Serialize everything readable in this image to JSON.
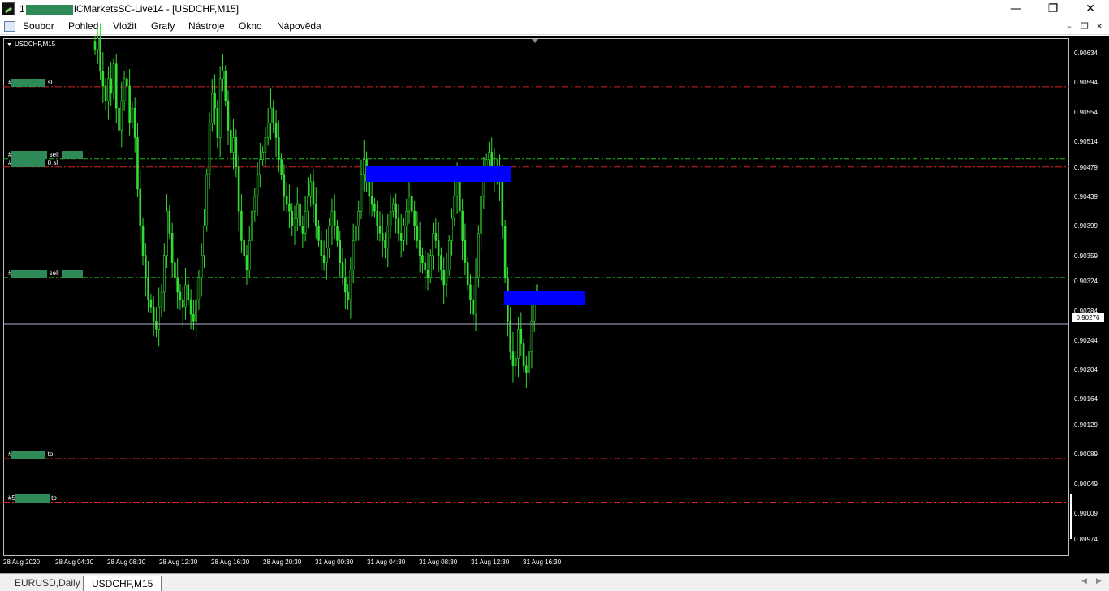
{
  "window": {
    "title_prefix": "1",
    "title_suffix": "ICMarketsSC-Live14 - [USDCHF,M15]",
    "minimize": "—",
    "restore": "❐",
    "close": "✕"
  },
  "menu": {
    "items": [
      "Soubor",
      "Pohled",
      "Vložit",
      "Grafy",
      "Nástroje",
      "Okno",
      "Nápověda"
    ],
    "mdi_minimize": "–",
    "mdi_restore": "❐",
    "mdi_close": "✕"
  },
  "chart": {
    "symbol": "USDCHF,M15",
    "current_price": "0.90276",
    "candle_color": "#33dd33",
    "zone_color": "#0000ff",
    "sl_tp_line_color": "#dd2222",
    "order_line_color": "#22bb22",
    "price_ticks": [
      "0.90634",
      "0.90594",
      "0.90554",
      "0.90514",
      "0.90479",
      "0.90439",
      "0.90399",
      "0.90359",
      "0.90324",
      "0.90284",
      "0.90244",
      "0.90204",
      "0.90164",
      "0.90129",
      "0.90089",
      "0.90049",
      "0.90009",
      "0.89974"
    ],
    "time_ticks": [
      "28 Aug 2020",
      "28 Aug 04:30",
      "28 Aug 08:30",
      "28 Aug 12:30",
      "28 Aug 16:30",
      "28 Aug 20:30",
      "31 Aug 00:30",
      "31 Aug 04:30",
      "31 Aug 08:30",
      "31 Aug 12:30",
      "31 Aug 16:30"
    ],
    "orders": [
      {
        "type": "sl",
        "label": "sl",
        "prefix": "#",
        "price": 0.90589
      },
      {
        "type": "sell",
        "label": "sell",
        "prefix": "#",
        "price": 0.90491
      },
      {
        "type": "sl",
        "label": "8 sl",
        "prefix": "#",
        "price": 0.9048
      },
      {
        "type": "sell",
        "label": "sell",
        "prefix": "#",
        "price": 0.9033
      },
      {
        "type": "tp",
        "label": "tp",
        "prefix": "#",
        "price": 0.90084
      },
      {
        "type": "tp",
        "label": "tp",
        "prefix": "#5",
        "price": 0.90025
      }
    ]
  },
  "tabs": [
    "EURUSD,Daily",
    "USDCHF,M15"
  ],
  "tab_scroll": {
    "left": "◀",
    "right": "▶"
  }
}
